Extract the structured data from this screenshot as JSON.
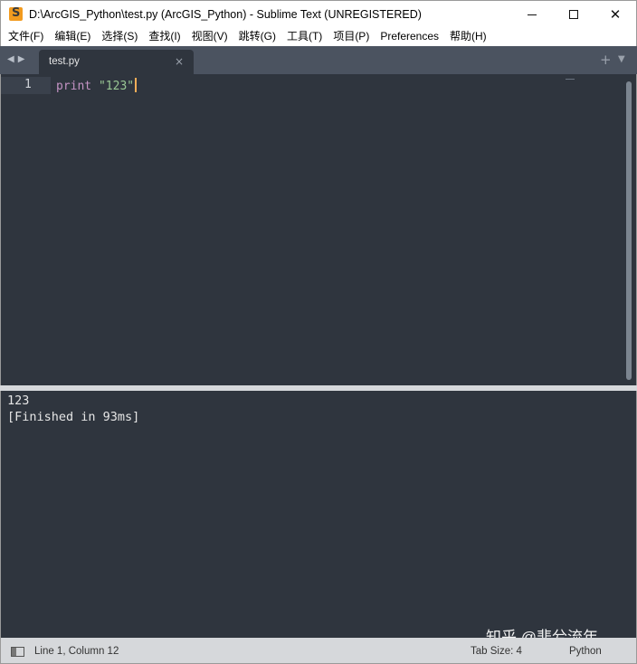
{
  "window": {
    "title": "D:\\ArcGIS_Python\\test.py (ArcGIS_Python) - Sublime Text (UNREGISTERED)",
    "app_icon": "sublime-text-icon",
    "minimize_icon": "minimize-icon",
    "maximize_icon": "maximize-icon",
    "close_glyph": "✕"
  },
  "menu": {
    "items": [
      {
        "label": "文件(F)"
      },
      {
        "label": "编辑(E)"
      },
      {
        "label": "选择(S)"
      },
      {
        "label": "查找(I)"
      },
      {
        "label": "视图(V)"
      },
      {
        "label": "跳转(G)"
      },
      {
        "label": "工具(T)"
      },
      {
        "label": "项目(P)"
      },
      {
        "label": "Preferences"
      },
      {
        "label": "帮助(H)"
      }
    ]
  },
  "tabs": {
    "nav_left": "◀",
    "nav_right": "▶",
    "active": {
      "label": "test.py",
      "close": "×"
    },
    "new_tab": "+",
    "dropdown": "▼"
  },
  "editor": {
    "line_number": "1",
    "keyword": "print",
    "string": "\"123\""
  },
  "output": {
    "lines": [
      "123",
      "[Finished in 93ms]"
    ],
    "watermark": "知乎 @悲兮流年"
  },
  "status": {
    "position": "Line 1, Column 12",
    "tab_size": "Tab Size: 4",
    "syntax": "Python"
  },
  "colors": {
    "editor_bg": "#2f353e",
    "tabbar_bg": "#4b5360",
    "keyword": "#c594c5",
    "string": "#99c794",
    "caret": "#f9ae58"
  }
}
